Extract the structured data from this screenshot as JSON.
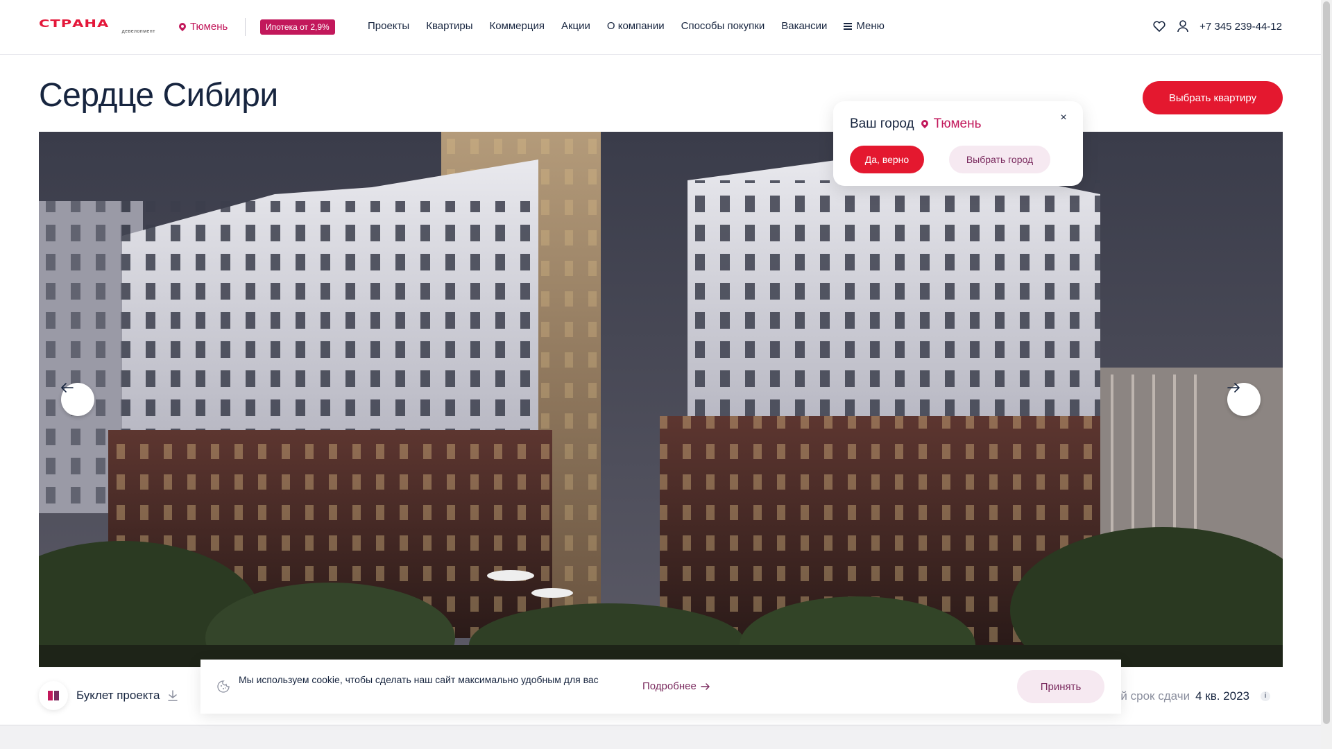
{
  "header": {
    "logo_text": "СТРАНА",
    "logo_sub": "девелопмент",
    "city": "Тюмень",
    "mortgage_badge": "Ипотека от 2,9%",
    "nav": [
      "Проекты",
      "Квартиры",
      "Коммерция",
      "Акции",
      "О компании",
      "Способы покупки",
      "Вакансии"
    ],
    "menu_label": "Меню",
    "phone": "+7 345 239-44-12",
    "icons": [
      "heart-icon",
      "user-icon"
    ]
  },
  "main": {
    "title": "Сердце Сибири",
    "choose_button": "Выбрать квартиру"
  },
  "city_popup": {
    "question": "Ваш город",
    "city": "Тюмень",
    "close": "×",
    "yes_button": "Да, верно",
    "choose_button": "Выбрать город"
  },
  "bottom": {
    "booklet_label": "Буклет проекта",
    "deadline_label": "ий срок сдачи",
    "deadline_value": "4 кв. 2023",
    "info_icon": "i"
  },
  "cookie": {
    "text": "Мы используем cookie, чтобы сделать наш сайт максимально удобным для вас",
    "more_link": "Подробнее",
    "accept_button": "Принять"
  },
  "colors": {
    "brand_red": "#e4182f",
    "brand_magenta": "#c2185b",
    "text_dark": "#17253f",
    "soft_pink": "#f6e9f1"
  }
}
